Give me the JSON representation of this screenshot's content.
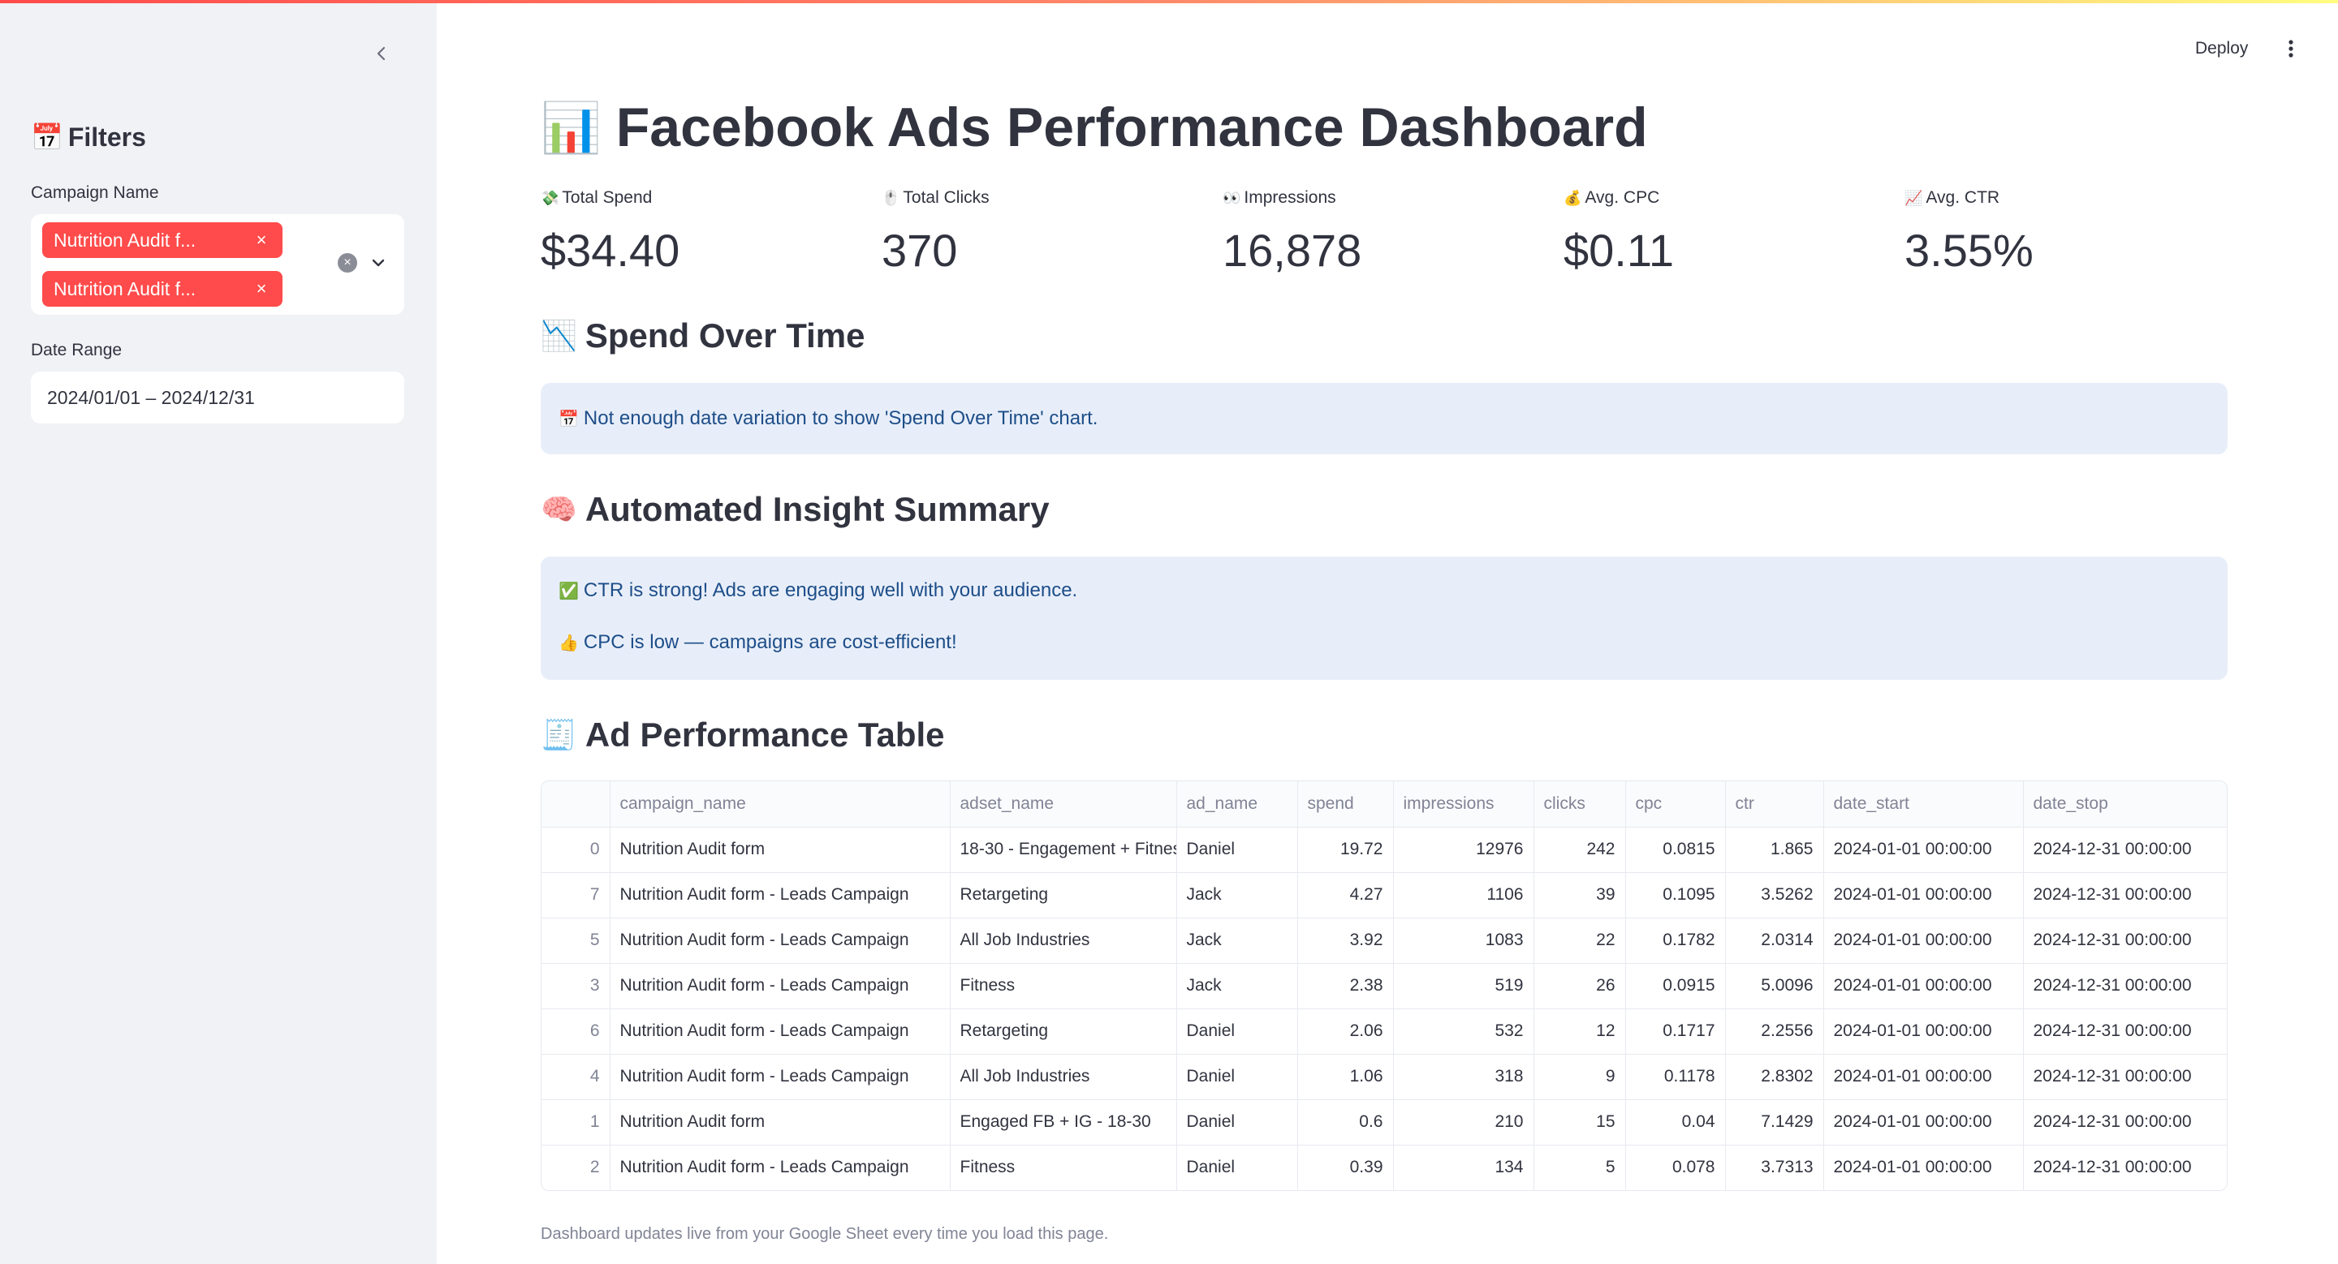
{
  "sidebar": {
    "heading": "Filters",
    "heading_icon": "📅",
    "campaign_label": "Campaign Name",
    "tags": [
      "Nutrition Audit f...",
      "Nutrition Audit f..."
    ],
    "date_label": "Date Range",
    "date_value": "2024/01/01 – 2024/12/31"
  },
  "header": {
    "deploy_label": "Deploy"
  },
  "main": {
    "title": "Facebook Ads Performance Dashboard",
    "title_icon": "📊",
    "metrics": [
      {
        "label": "Total Spend",
        "icon": "💸",
        "value": "$34.40"
      },
      {
        "label": "Total Clicks",
        "icon": "🖱️",
        "value": "370"
      },
      {
        "label": "Impressions",
        "icon": "👀",
        "value": "16,878"
      },
      {
        "label": "Avg. CPC",
        "icon": "💰",
        "value": "$0.11"
      },
      {
        "label": "Avg. CTR",
        "icon": "📈",
        "value": "3.55%"
      }
    ],
    "spend_section": {
      "title": "Spend Over Time",
      "icon": "📉",
      "message": "Not enough date variation to show 'Spend Over Time' chart.",
      "message_icon": "📅"
    },
    "insight_section": {
      "title": "Automated Insight Summary",
      "icon": "🧠",
      "lines": [
        {
          "icon": "✅",
          "text": "CTR is strong! Ads are engaging well with your audience."
        },
        {
          "icon": "👍",
          "text": "CPC is low — campaigns are cost-efficient!"
        }
      ]
    },
    "table_section": {
      "title": "Ad Performance Table",
      "icon": "🧾",
      "columns": [
        "",
        "campaign_name",
        "adset_name",
        "ad_name",
        "spend",
        "impressions",
        "clicks",
        "cpc",
        "ctr",
        "date_start",
        "date_stop"
      ],
      "rows": [
        [
          "0",
          "Nutrition Audit form",
          "18-30 - Engagement + Fitnes",
          "Daniel",
          "19.72",
          "12976",
          "242",
          "0.0815",
          "1.865",
          "2024-01-01 00:00:00",
          "2024-12-31 00:00:00"
        ],
        [
          "7",
          "Nutrition Audit form - Leads Campaign",
          "Retargeting",
          "Jack",
          "4.27",
          "1106",
          "39",
          "0.1095",
          "3.5262",
          "2024-01-01 00:00:00",
          "2024-12-31 00:00:00"
        ],
        [
          "5",
          "Nutrition Audit form - Leads Campaign",
          "All Job Industries",
          "Jack",
          "3.92",
          "1083",
          "22",
          "0.1782",
          "2.0314",
          "2024-01-01 00:00:00",
          "2024-12-31 00:00:00"
        ],
        [
          "3",
          "Nutrition Audit form - Leads Campaign",
          "Fitness",
          "Jack",
          "2.38",
          "519",
          "26",
          "0.0915",
          "5.0096",
          "2024-01-01 00:00:00",
          "2024-12-31 00:00:00"
        ],
        [
          "6",
          "Nutrition Audit form - Leads Campaign",
          "Retargeting",
          "Daniel",
          "2.06",
          "532",
          "12",
          "0.1717",
          "2.2556",
          "2024-01-01 00:00:00",
          "2024-12-31 00:00:00"
        ],
        [
          "4",
          "Nutrition Audit form - Leads Campaign",
          "All Job Industries",
          "Daniel",
          "1.06",
          "318",
          "9",
          "0.1178",
          "2.8302",
          "2024-01-01 00:00:00",
          "2024-12-31 00:00:00"
        ],
        [
          "1",
          "Nutrition Audit form",
          "Engaged FB + IG - 18-30",
          "Daniel",
          "0.6",
          "210",
          "15",
          "0.04",
          "7.1429",
          "2024-01-01 00:00:00",
          "2024-12-31 00:00:00"
        ],
        [
          "2",
          "Nutrition Audit form - Leads Campaign",
          "Fitness",
          "Daniel",
          "0.39",
          "134",
          "5",
          "0.078",
          "3.7313",
          "2024-01-01 00:00:00",
          "2024-12-31 00:00:00"
        ]
      ]
    },
    "footer_note": "Dashboard updates live from your Google Sheet every time you load this page."
  },
  "colors": {
    "accent": "#ff4b4b",
    "sidebar_bg": "#f0f2f6",
    "info_bg": "#e8eef9",
    "info_text": "#1d4e89"
  }
}
